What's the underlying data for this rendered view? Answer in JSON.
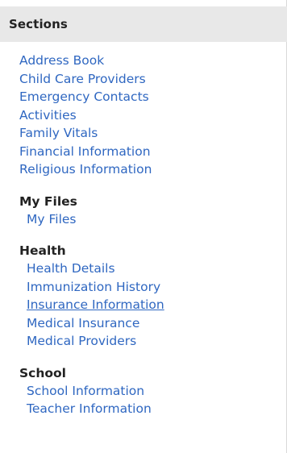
{
  "header": {
    "title": "Sections"
  },
  "main_links": [
    "Address Book",
    "Child Care Providers",
    "Emergency Contacts",
    "Activities",
    "Family Vitals",
    "Financial Information",
    "Religious Information"
  ],
  "my_files": {
    "title": "My Files",
    "links": [
      "My Files"
    ]
  },
  "health": {
    "title": "Health",
    "links": [
      "Health Details",
      "Immunization History",
      "Insurance Information",
      "Medical Insurance",
      "Medical Providers"
    ]
  },
  "school": {
    "title": "School",
    "links": [
      "School Information",
      "Teacher Information"
    ]
  },
  "colors": {
    "link": "#2f67c1",
    "header_bg": "#e8e8e8",
    "heading_text": "#222222"
  }
}
